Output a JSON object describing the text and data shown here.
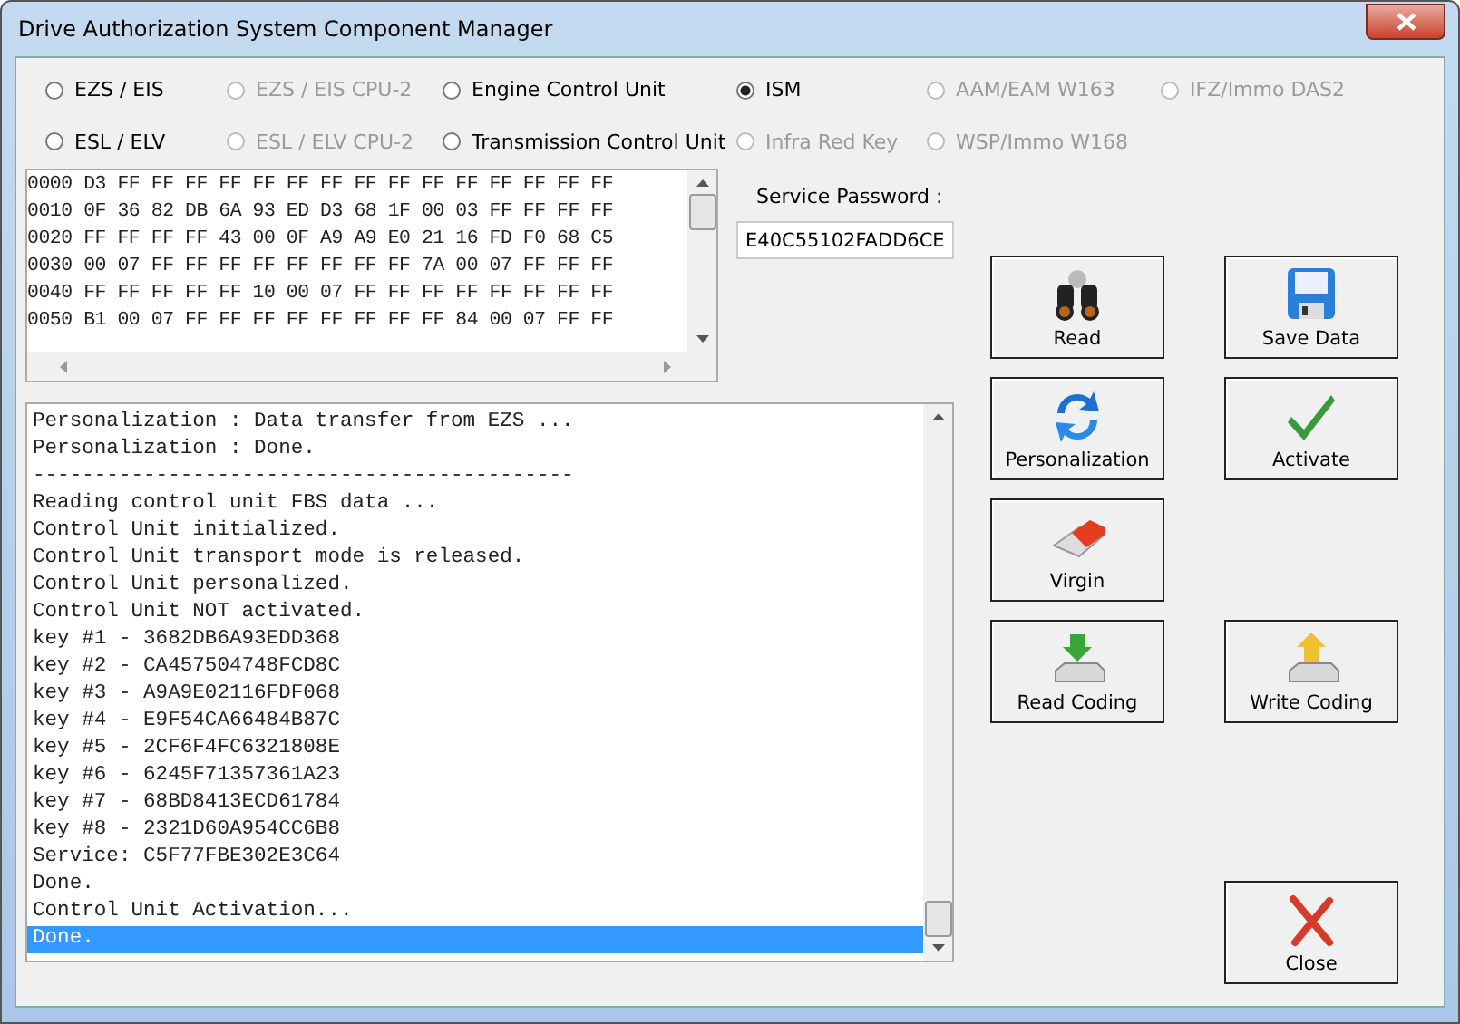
{
  "window": {
    "title": "Drive Authorization System Component Manager"
  },
  "radios": [
    {
      "label": "EZS / EIS",
      "selected": false,
      "disabled": false
    },
    {
      "label": "EZS / EIS CPU-2",
      "selected": false,
      "disabled": true
    },
    {
      "label": "Engine Control Unit",
      "selected": false,
      "disabled": false
    },
    {
      "label": "ISM",
      "selected": true,
      "disabled": false
    },
    {
      "label": "AAM/EAM W163",
      "selected": false,
      "disabled": true
    },
    {
      "label": "IFZ/Immo DAS2",
      "selected": false,
      "disabled": true
    },
    {
      "label": "ESL / ELV",
      "selected": false,
      "disabled": false
    },
    {
      "label": "ESL / ELV CPU-2",
      "selected": false,
      "disabled": true
    },
    {
      "label": "Transmission Control Unit",
      "selected": false,
      "disabled": false
    },
    {
      "label": "Infra Red Key",
      "selected": false,
      "disabled": true
    },
    {
      "label": "WSP/Immo W168",
      "selected": false,
      "disabled": true
    }
  ],
  "hex_dump": [
    "0000 D3 FF FF FF FF FF FF FF FF FF FF FF FF FF FF FF",
    "0010 0F 36 82 DB 6A 93 ED D3 68 1F 00 03 FF FF FF FF",
    "0020 FF FF FF FF 43 00 0F A9 A9 E0 21 16 FD F0 68 C5",
    "0030 00 07 FF FF FF FF FF FF FF FF 7A 00 07 FF FF FF",
    "0040 FF FF FF FF FF 10 00 07 FF FF FF FF FF FF FF FF",
    "0050 B1 00 07 FF FF FF FF FF FF FF FF 84 00 07 FF FF"
  ],
  "service_password": {
    "label": "Service Password :",
    "value": "E40C55102FADD6CE"
  },
  "log": [
    {
      "text": "Personalization : Data transfer from EZS ...",
      "selected": false
    },
    {
      "text": "Personalization : Done.",
      "selected": false
    },
    {
      "text": "--------------------------------------------",
      "selected": false
    },
    {
      "text": "Reading control unit FBS data ...",
      "selected": false
    },
    {
      "text": "Control Unit initialized.",
      "selected": false
    },
    {
      "text": "Control Unit transport mode is released.",
      "selected": false
    },
    {
      "text": "Control Unit personalized.",
      "selected": false
    },
    {
      "text": "Control Unit NOT activated.",
      "selected": false
    },
    {
      "text": "key #1 - 3682DB6A93EDD368",
      "selected": false
    },
    {
      "text": "key #2 - CA457504748FCD8C",
      "selected": false
    },
    {
      "text": "key #3 - A9A9E02116FDF068",
      "selected": false
    },
    {
      "text": "key #4 - E9F54CA66484B87C",
      "selected": false
    },
    {
      "text": "key #5 - 2CF6F4FC6321808E",
      "selected": false
    },
    {
      "text": "key #6 - 6245F71357361A23",
      "selected": false
    },
    {
      "text": "key #7 - 68BD8413ECD61784",
      "selected": false
    },
    {
      "text": "key #8 - 2321D60A954CC6B8",
      "selected": false
    },
    {
      "text": "Service: C5F77FBE302E3C64",
      "selected": false
    },
    {
      "text": "Done.",
      "selected": false
    },
    {
      "text": "Control Unit Activation...",
      "selected": false
    },
    {
      "text": "Done.",
      "selected": true
    }
  ],
  "buttons": [
    {
      "label": "Read",
      "kind": "read"
    },
    {
      "label": "Save Data",
      "kind": "save"
    },
    {
      "label": "Personalization",
      "kind": "personalize"
    },
    {
      "label": "Activate",
      "kind": "activate"
    },
    {
      "label": "Virgin",
      "kind": "virgin"
    },
    {
      "label": "Read Coding",
      "kind": "read-coding"
    },
    {
      "label": "Write Coding",
      "kind": "write-coding"
    },
    {
      "label": "Close",
      "kind": "close"
    }
  ]
}
